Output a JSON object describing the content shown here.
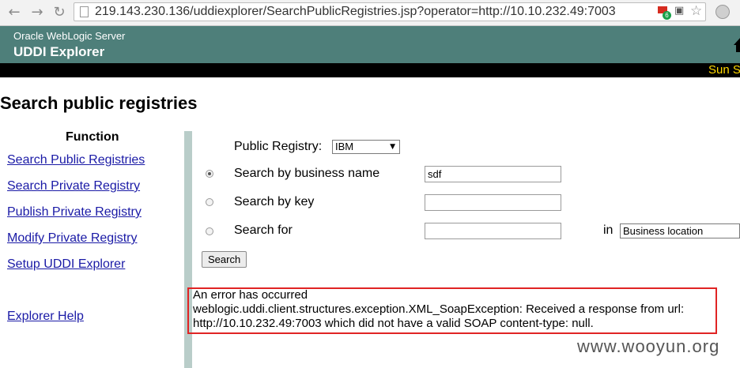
{
  "browser": {
    "url": "219.143.230.136/uddiexplorer/SearchPublicRegistries.jsp?operator=http://10.10.232.49:7003",
    "ext_badge": "6"
  },
  "header": {
    "subtitle": "Oracle WebLogic Server",
    "title": "UDDI Explorer",
    "ticker": "Sun S"
  },
  "page": {
    "title": "Search public registries"
  },
  "sidebar": {
    "heading": "Function",
    "links": [
      "Search Public Registries",
      "Search Private Registry",
      "Publish Private Registry",
      "Modify Private Registry",
      "Setup UDDI Explorer"
    ],
    "help": "Explorer Help"
  },
  "form": {
    "registry_label": "Public Registry:",
    "registry_value": "IBM",
    "by_name_label": "Search by business name",
    "by_name_value": "sdf",
    "by_key_label": "Search by key",
    "by_key_value": "",
    "search_for_label": "Search for",
    "search_for_value": "",
    "in_label": "in",
    "location_value": "Business location",
    "search_button": "Search"
  },
  "error": {
    "line1": "An error has occurred",
    "line2": "weblogic.uddi.client.structures.exception.XML_SoapException: Received a response from url:",
    "line3": "http://10.10.232.49:7003 which did not have a valid SOAP content-type: null."
  },
  "watermark": "www.wooyun.org"
}
